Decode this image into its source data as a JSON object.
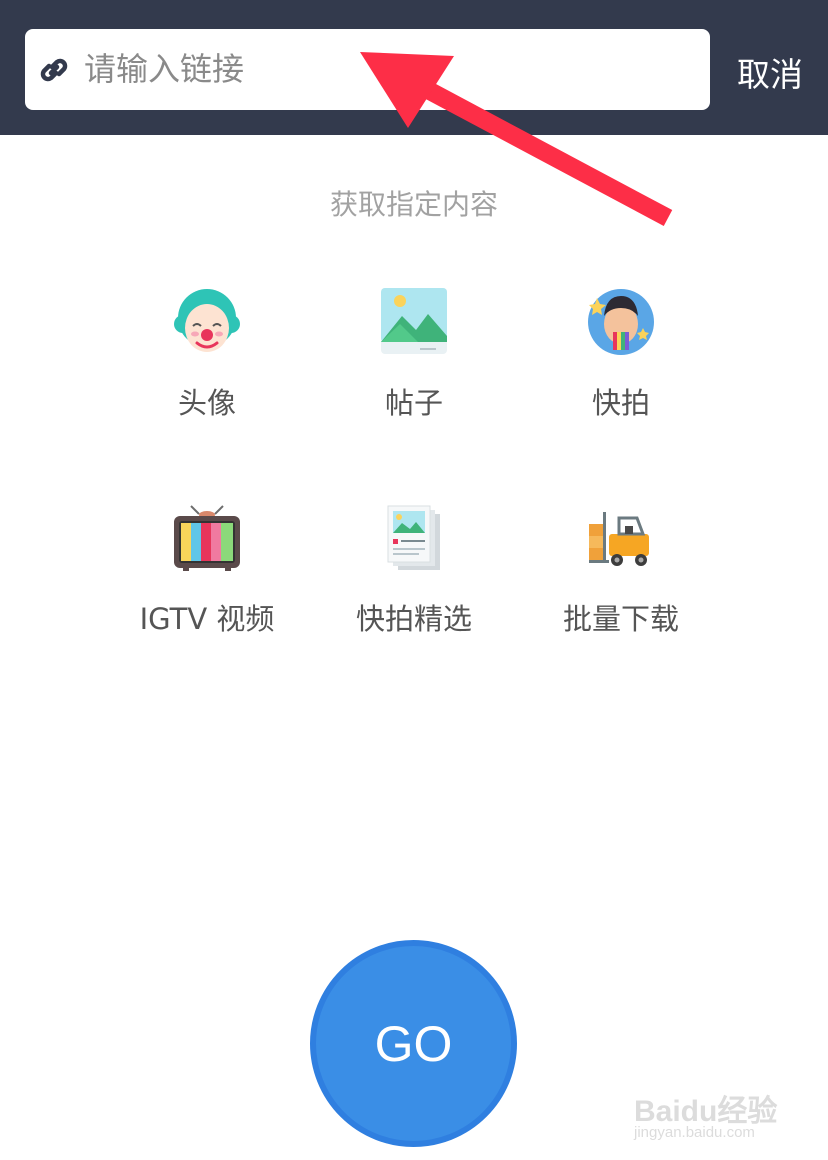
{
  "header": {
    "search_placeholder": "请输入链接",
    "search_value": "",
    "cancel_label": "取消",
    "icon": "link-icon"
  },
  "content": {
    "section_title": "获取指定内容",
    "items": [
      {
        "label": "头像",
        "icon": "clown-avatar-icon"
      },
      {
        "label": "帖子",
        "icon": "picture-post-icon"
      },
      {
        "label": "快拍",
        "icon": "story-face-icon"
      },
      {
        "label": "IGTV 视频",
        "icon": "tv-icon"
      },
      {
        "label": "快拍精选",
        "icon": "highlights-stack-icon"
      },
      {
        "label": "批量下载",
        "icon": "forklift-icon"
      }
    ]
  },
  "go_button": {
    "label": "GO"
  },
  "watermark": {
    "main": "Baidu经验",
    "sub": "jingyan.baidu.com"
  },
  "colors": {
    "header_bg": "#333a4d",
    "go_blue": "#3a8ee6",
    "arrow_red": "#fd2e47"
  }
}
